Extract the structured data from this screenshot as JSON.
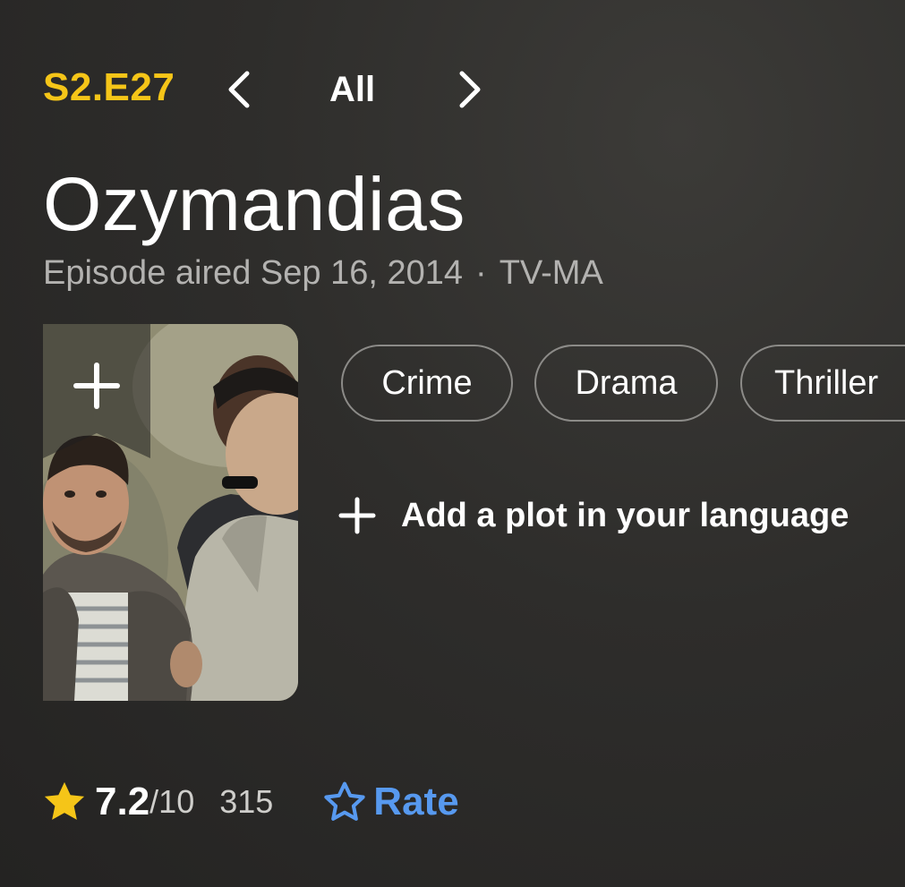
{
  "episode": {
    "code": "S2.E27",
    "all_label": "All",
    "title": "Ozymandias",
    "aired": "Episode aired Sep 16, 2014",
    "separator": "·",
    "certificate": "TV-MA"
  },
  "genres": [
    "Crime",
    "Drama",
    "Thriller"
  ],
  "plot": {
    "add_label": "Add a plot in your language"
  },
  "rating": {
    "value": "7.2",
    "max": "/10",
    "votes": "315",
    "rate_label": "Rate"
  },
  "colors": {
    "accent_yellow": "#f5c518",
    "link_blue": "#5799ef",
    "background": "#2e2d2b",
    "muted_text": "#b3b2b0"
  },
  "icons": {
    "prev": "chevron-left-icon",
    "next": "chevron-right-icon",
    "watchlist": "plus-icon",
    "add_plot": "plus-icon",
    "rating": "star-filled-icon",
    "rate": "star-outline-icon"
  }
}
